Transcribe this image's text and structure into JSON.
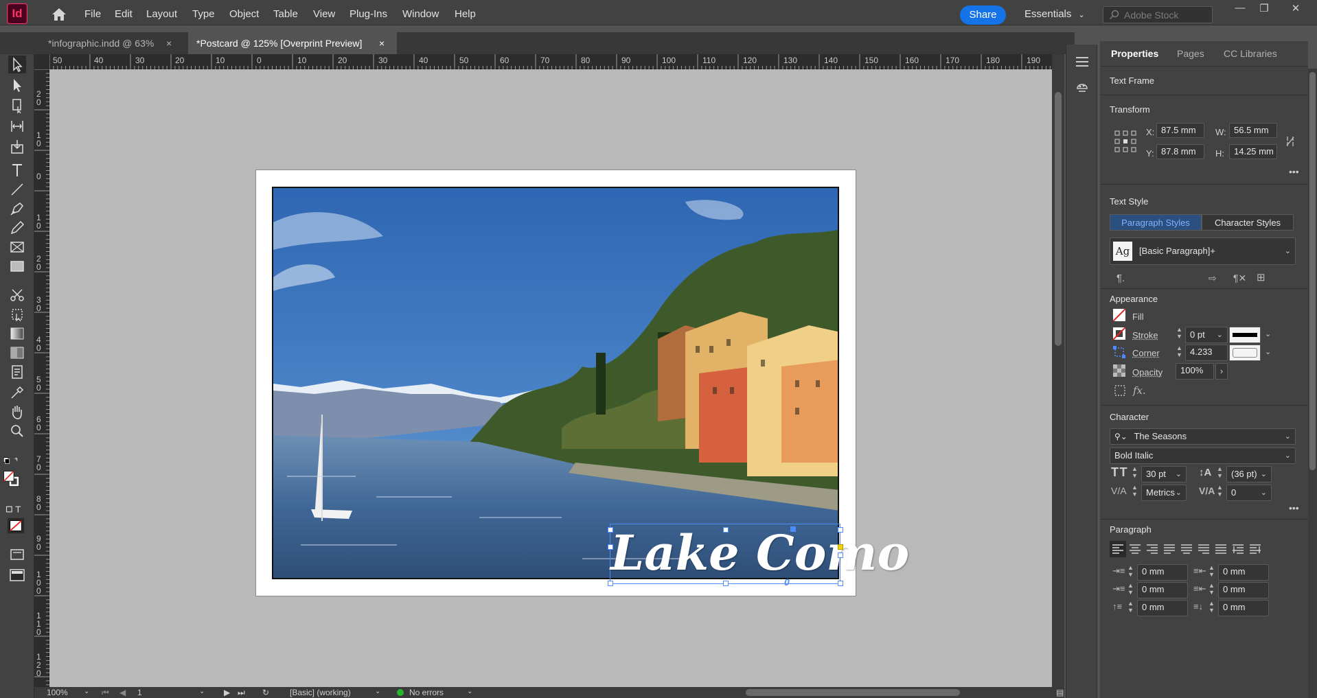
{
  "app": {
    "logo_text": "Id"
  },
  "menu": [
    "File",
    "Edit",
    "Layout",
    "Type",
    "Object",
    "Table",
    "View",
    "Plug-Ins",
    "Window",
    "Help"
  ],
  "topbar": {
    "share_label": "Share",
    "workspace_label": "Essentials",
    "search_placeholder": "Adobe Stock"
  },
  "tabs": [
    {
      "label": "*infographic.indd @ 63%",
      "active": false
    },
    {
      "label": "*Postcard @ 125% [Overprint Preview]",
      "active": true
    }
  ],
  "ruler_top": [
    "50",
    "40",
    "30",
    "20",
    "10",
    "0",
    "10",
    "20",
    "30",
    "40",
    "50",
    "60",
    "70",
    "80",
    "90",
    "100",
    "110",
    "120",
    "130",
    "140",
    "150",
    "160",
    "170",
    "180",
    "190"
  ],
  "ruler_left": [
    "2\n0",
    "1\n0",
    "0",
    "1\n0",
    "2\n0",
    "3\n0",
    "4\n0",
    "5\n0",
    "6\n0",
    "7\n0",
    "8\n0",
    "9\n0",
    "1\n0\n0",
    "1\n1\n0",
    "1\n2\n0"
  ],
  "document": {
    "caption": "Lake Como"
  },
  "status": {
    "zoom": "100%",
    "page": "1",
    "style": "[Basic] (working)",
    "preflight": "No errors"
  },
  "properties": {
    "tabs": [
      "Properties",
      "Pages",
      "CC Libraries"
    ],
    "object_type": "Text Frame",
    "transform": {
      "title": "Transform",
      "x_label": "X:",
      "x": "87.5 mm",
      "y_label": "Y:",
      "y": "87.8 mm",
      "w_label": "W:",
      "w": "56.5 mm",
      "h_label": "H:",
      "h": "14.25 mm"
    },
    "text_style": {
      "title": "Text Style",
      "paragraph_tab": "Paragraph Styles",
      "character_tab": "Character Styles",
      "style_icon": "Ag",
      "current_style": "[Basic Paragraph]+"
    },
    "appearance": {
      "title": "Appearance",
      "fill_label": "Fill",
      "stroke_label": "Stroke",
      "stroke_weight": "0 pt",
      "corner_label": "Corner",
      "corner_value": "4.233 mm",
      "opacity_label": "Opacity",
      "opacity_value": "100%",
      "fx_label": "fx."
    },
    "character": {
      "title": "Character",
      "font_family": "The Seasons",
      "font_style": "Bold Italic",
      "font_size": "30 pt",
      "leading": "(36 pt)",
      "kerning": "Metrics",
      "tracking": "0"
    },
    "paragraph": {
      "title": "Paragraph",
      "left_indent": "0 mm",
      "right_indent": "0 mm",
      "first_line_indent": "0 mm",
      "last_line_indent": "0 mm",
      "space_before": "0 mm",
      "space_after": "0 mm"
    }
  },
  "colors": {
    "accent": "#1473e6",
    "logo": "#ff3366",
    "selection": "#4c8cff"
  }
}
